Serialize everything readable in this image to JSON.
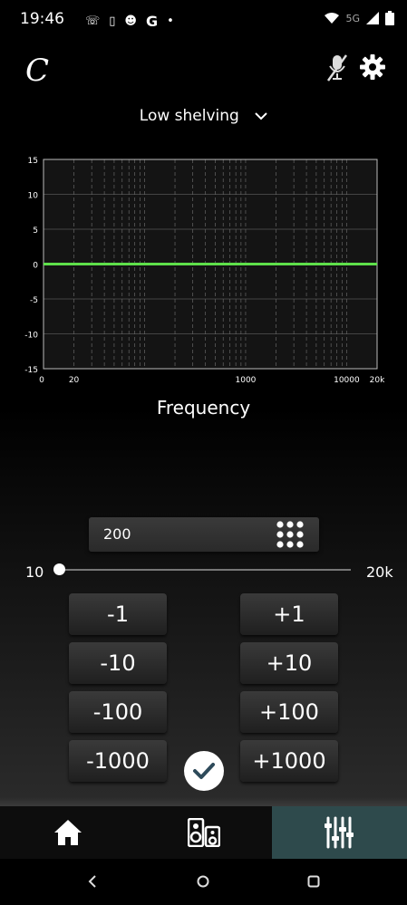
{
  "status": {
    "time": "19:46",
    "network": "5G"
  },
  "app": {
    "logo_text": "C"
  },
  "header": {
    "preset": "Low shelving"
  },
  "chart_data": {
    "type": "line",
    "x_scale": "log",
    "x_ticks": [
      "0",
      "20",
      "1000",
      "10000",
      "20k"
    ],
    "y_ticks": [
      "15",
      "10",
      "5",
      "0",
      "-5",
      "-10",
      "-15"
    ],
    "ylim": [
      -15,
      15
    ],
    "xlim": [
      10,
      20000
    ],
    "series": [
      {
        "x": [
          10,
          20000
        ],
        "y": [
          0,
          0
        ],
        "color": "#5ee04a"
      }
    ],
    "xlabel": "Frequency",
    "grid": true
  },
  "frequency": {
    "value": "200",
    "min_label": "10",
    "max_label": "20k",
    "slider_fraction": 0.0
  },
  "buttons": {
    "minus": [
      "-1",
      "-10",
      "-100",
      "-1000"
    ],
    "plus": [
      "+1",
      "+10",
      "+100",
      "+1000"
    ]
  },
  "tabs": [
    "home-icon",
    "speaker-icon",
    "equalizer-icon"
  ],
  "colors": {
    "accent": "#5ee04a",
    "active_tab": "#2e4a4c",
    "confirm_check": "#2e4a5a"
  }
}
